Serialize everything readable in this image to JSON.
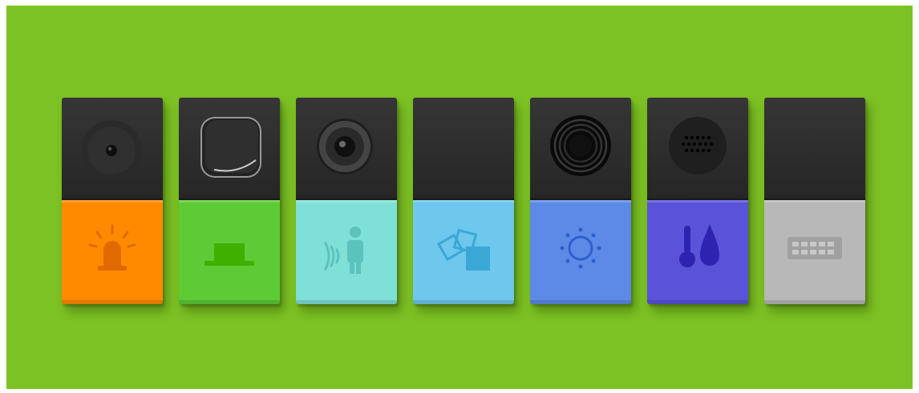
{
  "modules": [
    {
      "kind": "led",
      "top_feature": "led-lens",
      "icon": "siren-icon",
      "color": "#ff8a00",
      "icon_color": "#e06a00"
    },
    {
      "kind": "button",
      "top_feature": "push-button",
      "icon": "push-button-icon",
      "color": "#5ccb35",
      "icon_color": "#3eb000"
    },
    {
      "kind": "motion",
      "top_feature": "camera-lens",
      "icon": "motion-sensor-icon",
      "color": "#7fe0d8",
      "icon_color": "#5cc2bb"
    },
    {
      "kind": "move",
      "top_feature": "none",
      "icon": "move-icon",
      "color": "#6ec7ec",
      "icon_color": "#3aa8d6"
    },
    {
      "kind": "brightness",
      "top_feature": "buzzer-grille",
      "icon": "brightness-icon",
      "color": "#5c8ae6",
      "icon_color": "#2e5fd0"
    },
    {
      "kind": "temperature-humidity",
      "top_feature": "speaker-holes",
      "icon": "temperature-humidity-icon",
      "color": "#5a52d8",
      "icon_color": "#2d23b0"
    },
    {
      "kind": "gpio",
      "top_feature": "none",
      "icon": "keyboard-icon",
      "color": "#b8b8b8",
      "icon_color": "#9a9a9a"
    }
  ]
}
